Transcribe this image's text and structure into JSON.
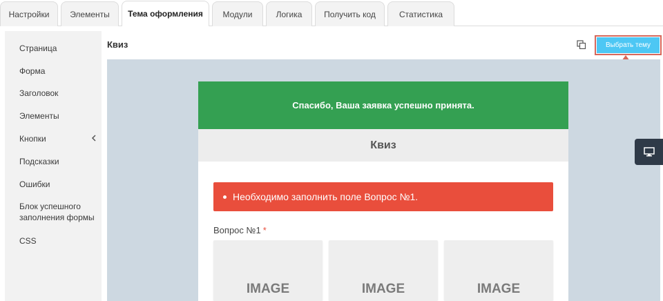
{
  "tabs": [
    {
      "label": "Настройки"
    },
    {
      "label": "Элементы"
    },
    {
      "label": "Тема оформления"
    },
    {
      "label": "Модули"
    },
    {
      "label": "Логика"
    },
    {
      "label": "Получить код"
    },
    {
      "label": "Статистика"
    }
  ],
  "active_tab": "Тема оформления",
  "sidebar": {
    "items": [
      {
        "label": "Страница"
      },
      {
        "label": "Форма"
      },
      {
        "label": "Заголовок"
      },
      {
        "label": "Элементы"
      },
      {
        "label": "Кнопки"
      },
      {
        "label": "Подсказки"
      },
      {
        "label": "Ошибки"
      },
      {
        "label": "Блок успешного заполнения формы"
      },
      {
        "label": "CSS"
      }
    ]
  },
  "header": {
    "title": "Квиз",
    "choose_theme_label": "Выбрать тему"
  },
  "preview": {
    "success_message": "Спасибо, Ваша заявка успешно принята.",
    "form_title": "Квиз",
    "error_message": "Необходимо заполнить поле Вопрос №1.",
    "question_label": "Вопрос №1",
    "required_mark": "*",
    "image_options": [
      {
        "label": "IMAGE"
      },
      {
        "label": "IMAGE"
      },
      {
        "label": "IMAGE"
      }
    ]
  },
  "icons": {
    "copy": "copy-icon",
    "monitor": "monitor-icon",
    "chevron": "chevron-left-icon"
  },
  "colors": {
    "success": "#34a052",
    "error": "#e94e3c",
    "accent_button": "#4dc7f4",
    "highlight": "#d6675a",
    "preview_bg": "#cdd8e1"
  }
}
